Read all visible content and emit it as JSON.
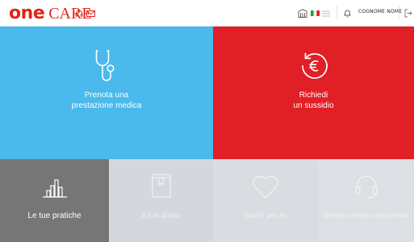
{
  "brand": {
    "one": "one",
    "care": "CARE"
  },
  "header": {
    "headset_icon": "headset-icon",
    "mail_icon": "mail-icon",
    "building_icon": "building-icon",
    "flag_icon": "italy-flag-icon",
    "menu_icon": "menu-icon",
    "bell_icon": "bell-icon",
    "user_name": "COGNOME NOME",
    "logout_icon": "logout-icon"
  },
  "colors": {
    "brand_red": "#e2231a",
    "tile_blue": "#4ab9eb",
    "tile_red": "#e11f26",
    "tile_dark": "#767676",
    "tile_light": "#d6d9de"
  },
  "tiles": {
    "prenota": {
      "line1": "Prenota una",
      "line2": "prestazione medica",
      "icon": "stethoscope-icon"
    },
    "sussidio": {
      "line1": "Richiedi",
      "line2": "un sussidio",
      "icon": "euro-refund-icon"
    },
    "pratiche": {
      "label": "Le tue pratiche",
      "icon": "bar-chart-icon"
    },
    "diario": {
      "label": "Il tuo diario",
      "icon": "notebook-icon"
    },
    "scelti": {
      "label": "Scelti per te",
      "icon": "heart-icon"
    },
    "contatti": {
      "label": "Medico sempre disponibile",
      "icon": "headset-icon"
    }
  }
}
